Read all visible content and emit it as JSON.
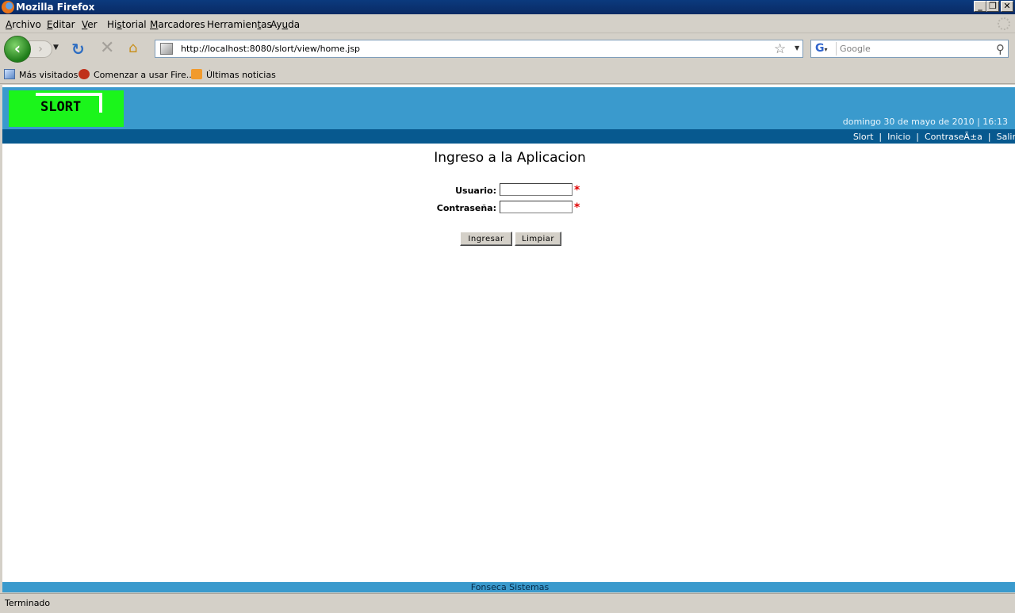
{
  "window": {
    "title": "Mozilla Firefox",
    "controls": {
      "minimize": "_",
      "restore": "❐",
      "close": "✕"
    }
  },
  "menu": [
    {
      "pre": "",
      "key": "A",
      "post": "rchivo"
    },
    {
      "pre": "",
      "key": "E",
      "post": "ditar"
    },
    {
      "pre": "",
      "key": "V",
      "post": "er"
    },
    {
      "pre": "Hi",
      "key": "s",
      "post": "torial"
    },
    {
      "pre": "",
      "key": "M",
      "post": "arcadores"
    },
    {
      "pre": "Herramien",
      "key": "t",
      "post": "as"
    },
    {
      "pre": "Ay",
      "key": "u",
      "post": "da"
    }
  ],
  "navigation": {
    "url": "http://localhost:8080/slort/view/home.jsp",
    "search_placeholder": "Google",
    "search_engine": "G"
  },
  "bookmarks": [
    {
      "label": "Más visitados",
      "icon": "smart-bookmark-icon"
    },
    {
      "label": "Comenzar a usar Fire...",
      "icon": "firefox-icon"
    },
    {
      "label": "Últimas noticias",
      "icon": "rss-icon"
    }
  ],
  "site": {
    "logo_text": "SLORT",
    "datetime": "domingo 30 de mayo de 2010 | 16:13",
    "nav": [
      {
        "label": "Slort"
      },
      {
        "label": "Inicio"
      },
      {
        "label": "ContraseÃ±a"
      },
      {
        "label": "Salir"
      }
    ],
    "separator": "|",
    "colors": {
      "header": "#3a9acd",
      "navstrip": "#07598f",
      "logo": "#1bf51b"
    }
  },
  "login": {
    "title": "Ingreso a la Aplicacion",
    "user_label": "Usuario:",
    "password_label": "Contraseña:",
    "required_mark": "*",
    "submit_label": "Ingresar",
    "reset_label": "Limpiar"
  },
  "footer": {
    "text": "Fonseca Sistemas"
  },
  "status": {
    "text": "Terminado"
  }
}
